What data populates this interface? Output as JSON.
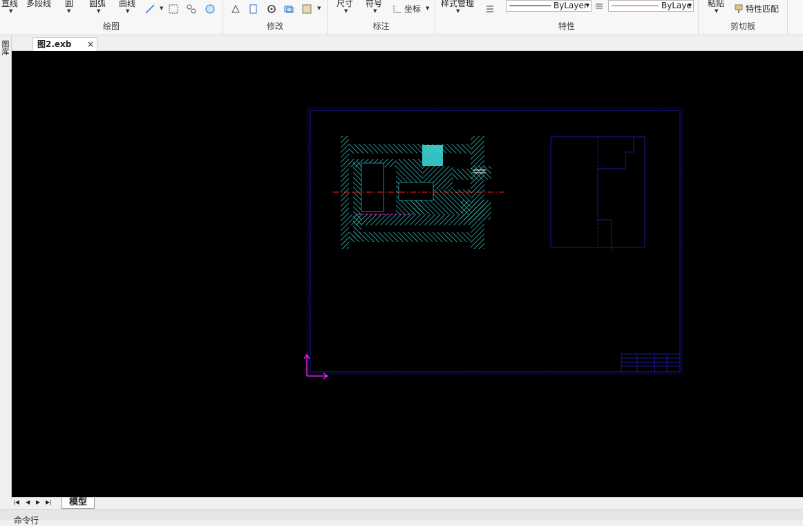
{
  "ribbon": {
    "draw": {
      "line_label": "直线",
      "polyline_label": "多段线",
      "circle_label": "圆",
      "arc_label": "圆弧",
      "curve_label": "曲线",
      "title": "绘图"
    },
    "modify": {
      "title": "修改"
    },
    "annotate": {
      "dimension_label": "尺寸",
      "symbol_label": "符号",
      "coordinate_label": "坐标",
      "title": "标注"
    },
    "properties": {
      "style_manager_label": "样式管理",
      "linetype_value": "ByLayer",
      "color_value": "ByLaye",
      "title": "特性"
    },
    "clipboard": {
      "paste_label": "粘贴",
      "match_properties_label": "特性匹配",
      "title": "剪切板"
    }
  },
  "side_panel": {
    "label": "图库"
  },
  "tabs": {
    "document_name": "图2.exb",
    "close_symbol": "×"
  },
  "layout": {
    "nav_first": "|◀",
    "nav_prev": "◀",
    "nav_next": "▶",
    "nav_last": "▶|",
    "model_tab": "模型"
  },
  "command": {
    "label": "命令行"
  },
  "colors": {
    "canvas_bg": "#000000",
    "frame_line": "#1a1a9a",
    "hatch": "#40e0e0",
    "centerline": "#ff2020",
    "ucs": "#e020e0"
  }
}
